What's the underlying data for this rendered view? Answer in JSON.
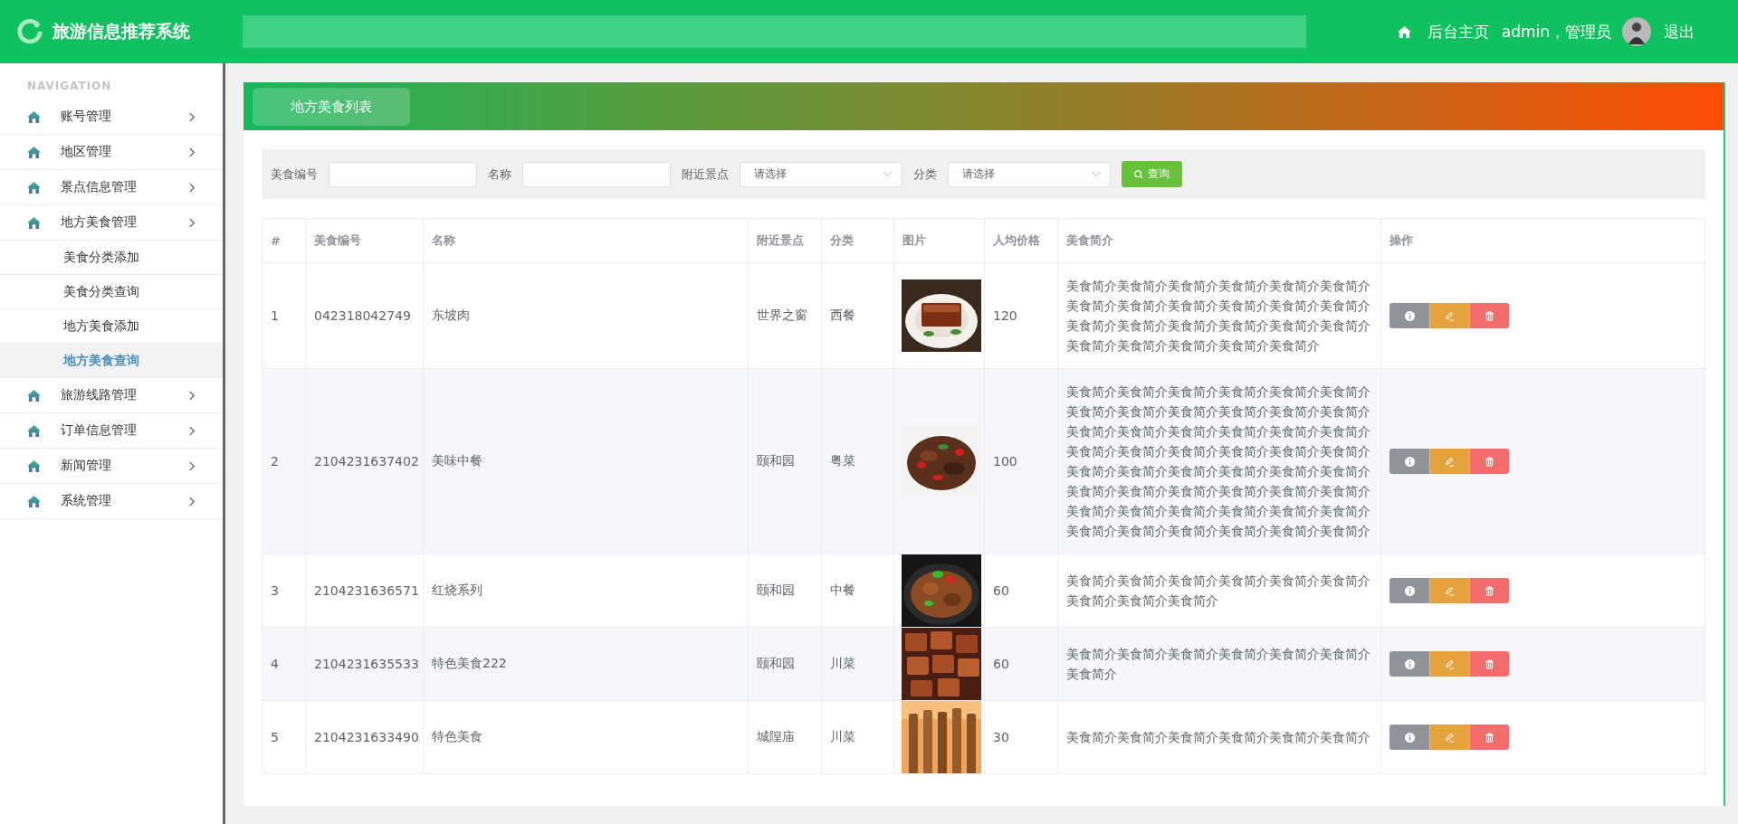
{
  "header": {
    "title": "旅游信息推荐系统",
    "home_link": "后台主页",
    "user": "admin，管理员",
    "logout": "退出"
  },
  "sidebar": {
    "heading": "NAVIGATION",
    "items": [
      {
        "label": "账号管理"
      },
      {
        "label": "地区管理"
      },
      {
        "label": "景点信息管理"
      },
      {
        "label": "地方美食管理",
        "children": [
          {
            "label": "美食分类添加",
            "selected": false
          },
          {
            "label": "美食分类查询",
            "selected": false
          },
          {
            "label": "地方美食添加",
            "selected": false
          },
          {
            "label": "地方美食查询",
            "selected": true
          }
        ]
      },
      {
        "label": "旅游线路管理"
      },
      {
        "label": "订单信息管理"
      },
      {
        "label": "新闻管理"
      },
      {
        "label": "系统管理"
      }
    ]
  },
  "panel": {
    "title": "地方美食列表"
  },
  "filters": [
    {
      "kind": "input",
      "label": "美食编号"
    },
    {
      "kind": "input",
      "label": "名称"
    },
    {
      "kind": "select",
      "label": "附近景点",
      "placeholder": "请选择"
    },
    {
      "kind": "select",
      "label": "分类",
      "placeholder": "请选择"
    }
  ],
  "search_button": "查询",
  "table": {
    "columns": [
      "#",
      "美食编号",
      "名称",
      "附近景点",
      "分类",
      "图片",
      "人均价格",
      "美食简介",
      "操作"
    ],
    "rows": [
      {
        "index": "1",
        "code": "042318042749",
        "name": "东坡肉",
        "spot": "世界之窗",
        "category": "西餐",
        "price": "120",
        "description": "美食简介美食简介美食简介美食简介美食简介美食简介美食简介美食简介美食简介美食简介美食简介美食简介美食简介美食简介美食简介美食简介美食简介美食简介美食简介美食简介美食简介美食简介美食简介"
      },
      {
        "index": "2",
        "code": "2104231637402",
        "name": "美味中餐",
        "spot": "颐和园",
        "category": "粤菜",
        "price": "100",
        "description": "美食简介美食简介美食简介美食简介美食简介美食简介美食简介美食简介美食简介美食简介美食简介美食简介美食简介美食简介美食简介美食简介美食简介美食简介美食简介美食简介美食简介美食简介美食简介美食简介美食简介美食简介美食简介美食简介美食简介美食简介美食简介美食简介美食简介美食简介美食简介美食简介美食简介美食简介美食简介美食简介美食简介美食简介美食简介美食简介美食简介美食简介美食简介美食简介"
      },
      {
        "index": "3",
        "code": "2104231636571",
        "name": "红烧系列",
        "spot": "颐和园",
        "category": "中餐",
        "price": "60",
        "description": "美食简介美食简介美食简介美食简介美食简介美食简介美食简介美食简介美食简介"
      },
      {
        "index": "4",
        "code": "2104231635533",
        "name": "特色美食222",
        "spot": "颐和园",
        "category": "川菜",
        "price": "60",
        "description": "美食简介美食简介美食简介美食简介美食简介美食简介美食简介"
      },
      {
        "index": "5",
        "code": "2104231633490",
        "name": "特色美食",
        "spot": "城隍庙",
        "category": "川菜",
        "price": "30",
        "description": "美食简介美食简介美食简介美食简介美食简介美食简介"
      }
    ]
  }
}
